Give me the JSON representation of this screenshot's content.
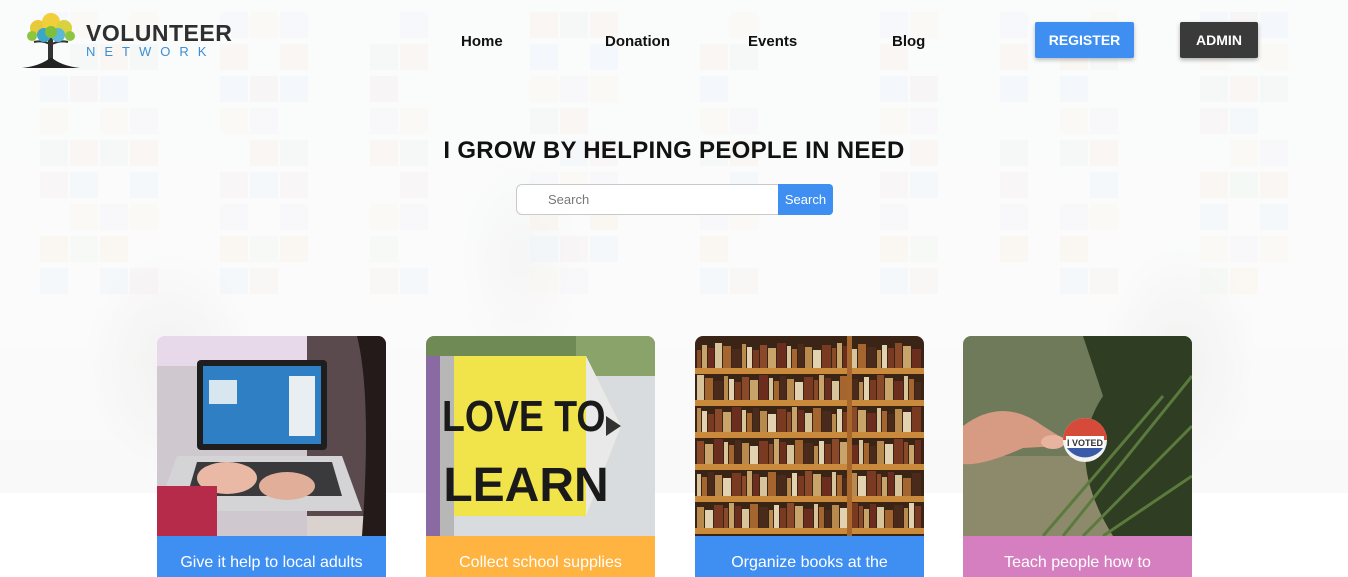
{
  "brand": {
    "title": "VOLUNTEER",
    "subtitle": "NETWORK"
  },
  "nav": {
    "home": "Home",
    "donation": "Donation",
    "events": "Events",
    "blog": "Blog"
  },
  "buttons": {
    "register": "REGISTER",
    "admin": "ADMIN"
  },
  "hero": {
    "title": "I GROW BY HELPING PEOPLE IN NEED"
  },
  "search": {
    "placeholder": "Search",
    "button": "Search"
  },
  "colors": {
    "primary": "#3f8ff2",
    "dark": "#3a3a3a",
    "orange": "#ffb340",
    "pink": "#d67fc0"
  },
  "cards": [
    {
      "caption": "Give it help to local adults",
      "color": "#3f8ff2",
      "image": "laptop-typing"
    },
    {
      "caption": "Collect school supplies",
      "color": "#ffb340",
      "image": "love-to-learn-sign"
    },
    {
      "caption": "Organize books at the",
      "color": "#3f8ff2",
      "image": "bookshelves"
    },
    {
      "caption": "Teach people how to",
      "color": "#d67fc0",
      "image": "i-voted-sticker"
    }
  ]
}
